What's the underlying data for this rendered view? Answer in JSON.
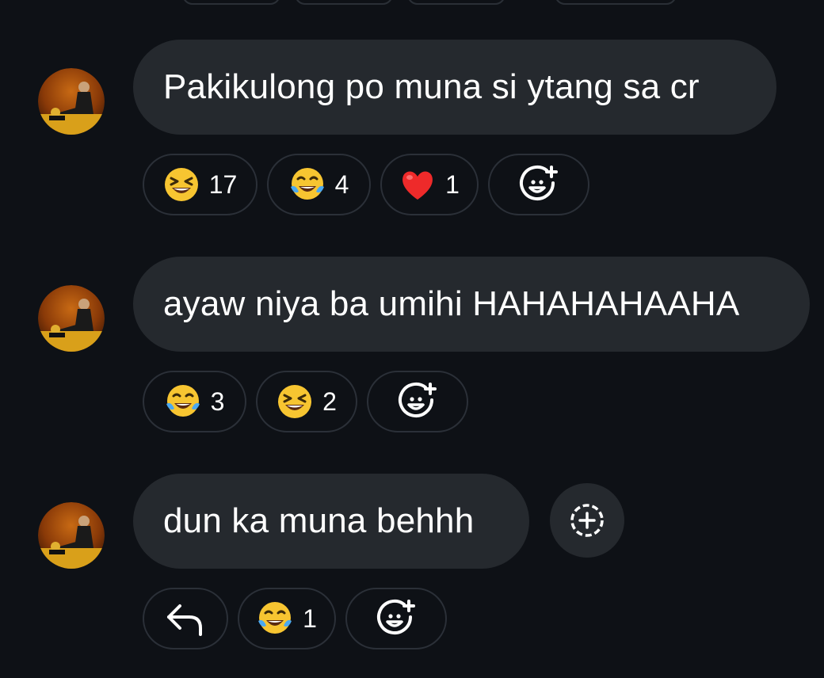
{
  "colors": {
    "background": "#0e1116",
    "bubble": "#25292e",
    "pill_border": "#2b3038"
  },
  "messages": [
    {
      "text": "Pakikulong po muna si ytang sa cr",
      "reactions": [
        {
          "icon": "grinning-squinting-face-icon",
          "count": "17"
        },
        {
          "icon": "face-with-tears-of-joy-icon",
          "count": "4"
        },
        {
          "icon": "red-heart-icon",
          "count": "1"
        }
      ],
      "add_reaction_icon": "add-reaction-icon"
    },
    {
      "text": "ayaw niya ba umihi HAHAHAHAAHA",
      "reactions": [
        {
          "icon": "face-with-tears-of-joy-icon",
          "count": "3"
        },
        {
          "icon": "grinning-squinting-face-icon",
          "count": "2"
        }
      ],
      "add_reaction_icon": "add-reaction-icon"
    },
    {
      "text": "dun ka muna behhh",
      "reply_icon": "reply-arrow-icon",
      "reactions": [
        {
          "icon": "face-with-tears-of-joy-icon",
          "count": "1"
        }
      ],
      "add_reaction_icon": "add-reaction-icon",
      "side_action_icon": "dashed-plus-circle-icon"
    }
  ]
}
